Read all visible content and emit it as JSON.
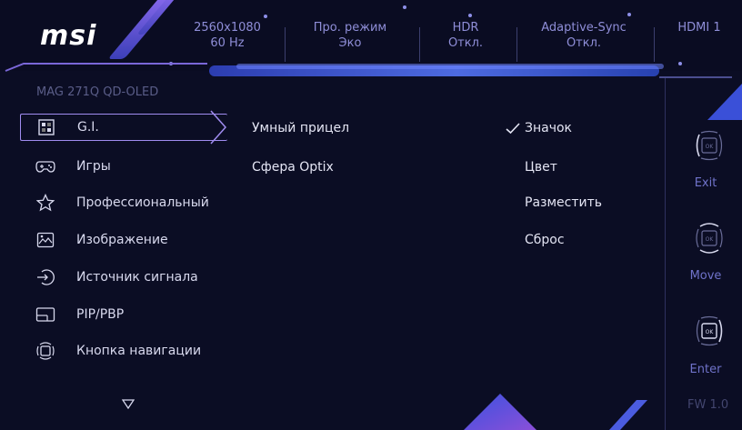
{
  "header": {
    "brand": "msi",
    "status": [
      {
        "line1": "2560x1080",
        "line2": "60 Hz"
      },
      {
        "line1": "Про. режим",
        "line2": "Эко"
      },
      {
        "line1": "HDR",
        "line2": "Откл."
      },
      {
        "line1": "Adaptive-Sync",
        "line2": "Откл."
      },
      {
        "line1": "HDMI 1",
        "line2": ""
      }
    ]
  },
  "model": "MAG 271Q QD-OLED",
  "menu": [
    {
      "label": "G.I.",
      "icon": "gi-icon"
    },
    {
      "label": "Игры",
      "icon": "gamepad-icon"
    },
    {
      "label": "Профессиональный",
      "icon": "star-icon"
    },
    {
      "label": "Изображение",
      "icon": "image-icon"
    },
    {
      "label": "Источник сигнала",
      "icon": "input-source-icon"
    },
    {
      "label": "PIP/PBP",
      "icon": "pip-icon"
    },
    {
      "label": "Кнопка навигации",
      "icon": "navigation-key-icon"
    }
  ],
  "submenu": [
    {
      "label": "Умный прицел"
    },
    {
      "label": "Сфера Optix"
    }
  ],
  "options": [
    {
      "label": "Значок",
      "checked": true
    },
    {
      "label": "Цвет",
      "checked": false
    },
    {
      "label": "Разместить",
      "checked": false
    },
    {
      "label": "Сброс",
      "checked": false
    }
  ],
  "controls": [
    {
      "label": "Exit",
      "icon": "navkey-left-icon"
    },
    {
      "label": "Move",
      "icon": "navkey-updown-icon"
    },
    {
      "label": "Enter",
      "icon": "navkey-right-icon"
    }
  ],
  "firmware": "FW 1.0",
  "colors": {
    "accent": "#a08cf0",
    "text": "#d8d9ee",
    "muted": "#6f72c9",
    "background": "#0b0d24"
  }
}
